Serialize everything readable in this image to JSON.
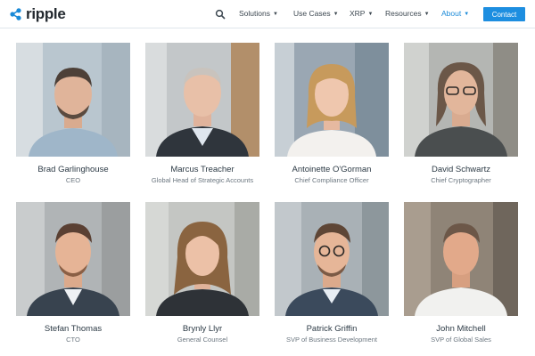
{
  "header": {
    "logo_text": "ripple",
    "nav": [
      {
        "label": "Solutions",
        "icon": "chevron-down-icon"
      },
      {
        "label": "Use Cases",
        "icon": "chevron-down-icon"
      },
      {
        "label": "XRP",
        "icon": "chevron-down-icon"
      },
      {
        "label": "Resources",
        "icon": "chevron-down-icon"
      },
      {
        "label": "About",
        "icon": "chevron-down-icon"
      }
    ],
    "contact_label": "Contact",
    "search_icon": "search-icon"
  },
  "colors": {
    "brand": "#23292f",
    "accent": "#1d8ee0",
    "active_nav": "#1a8ad8",
    "name_text": "#2c3a45",
    "title_text": "#6c7780"
  },
  "people": [
    {
      "name": "Brad Garlinghouse",
      "title": "CEO"
    },
    {
      "name": "Marcus Treacher",
      "title": "Global Head of Strategic Accounts"
    },
    {
      "name": "Antoinette O'Gorman",
      "title": "Chief Compliance Officer"
    },
    {
      "name": "David Schwartz",
      "title": "Chief Cryptographer"
    },
    {
      "name": "Stefan Thomas",
      "title": "CTO"
    },
    {
      "name": "Brynly Llyr",
      "title": "General Counsel"
    },
    {
      "name": "Patrick Griffin",
      "title": "SVP of Business Development"
    },
    {
      "name": "John Mitchell",
      "title": "SVP of Global Sales"
    }
  ]
}
